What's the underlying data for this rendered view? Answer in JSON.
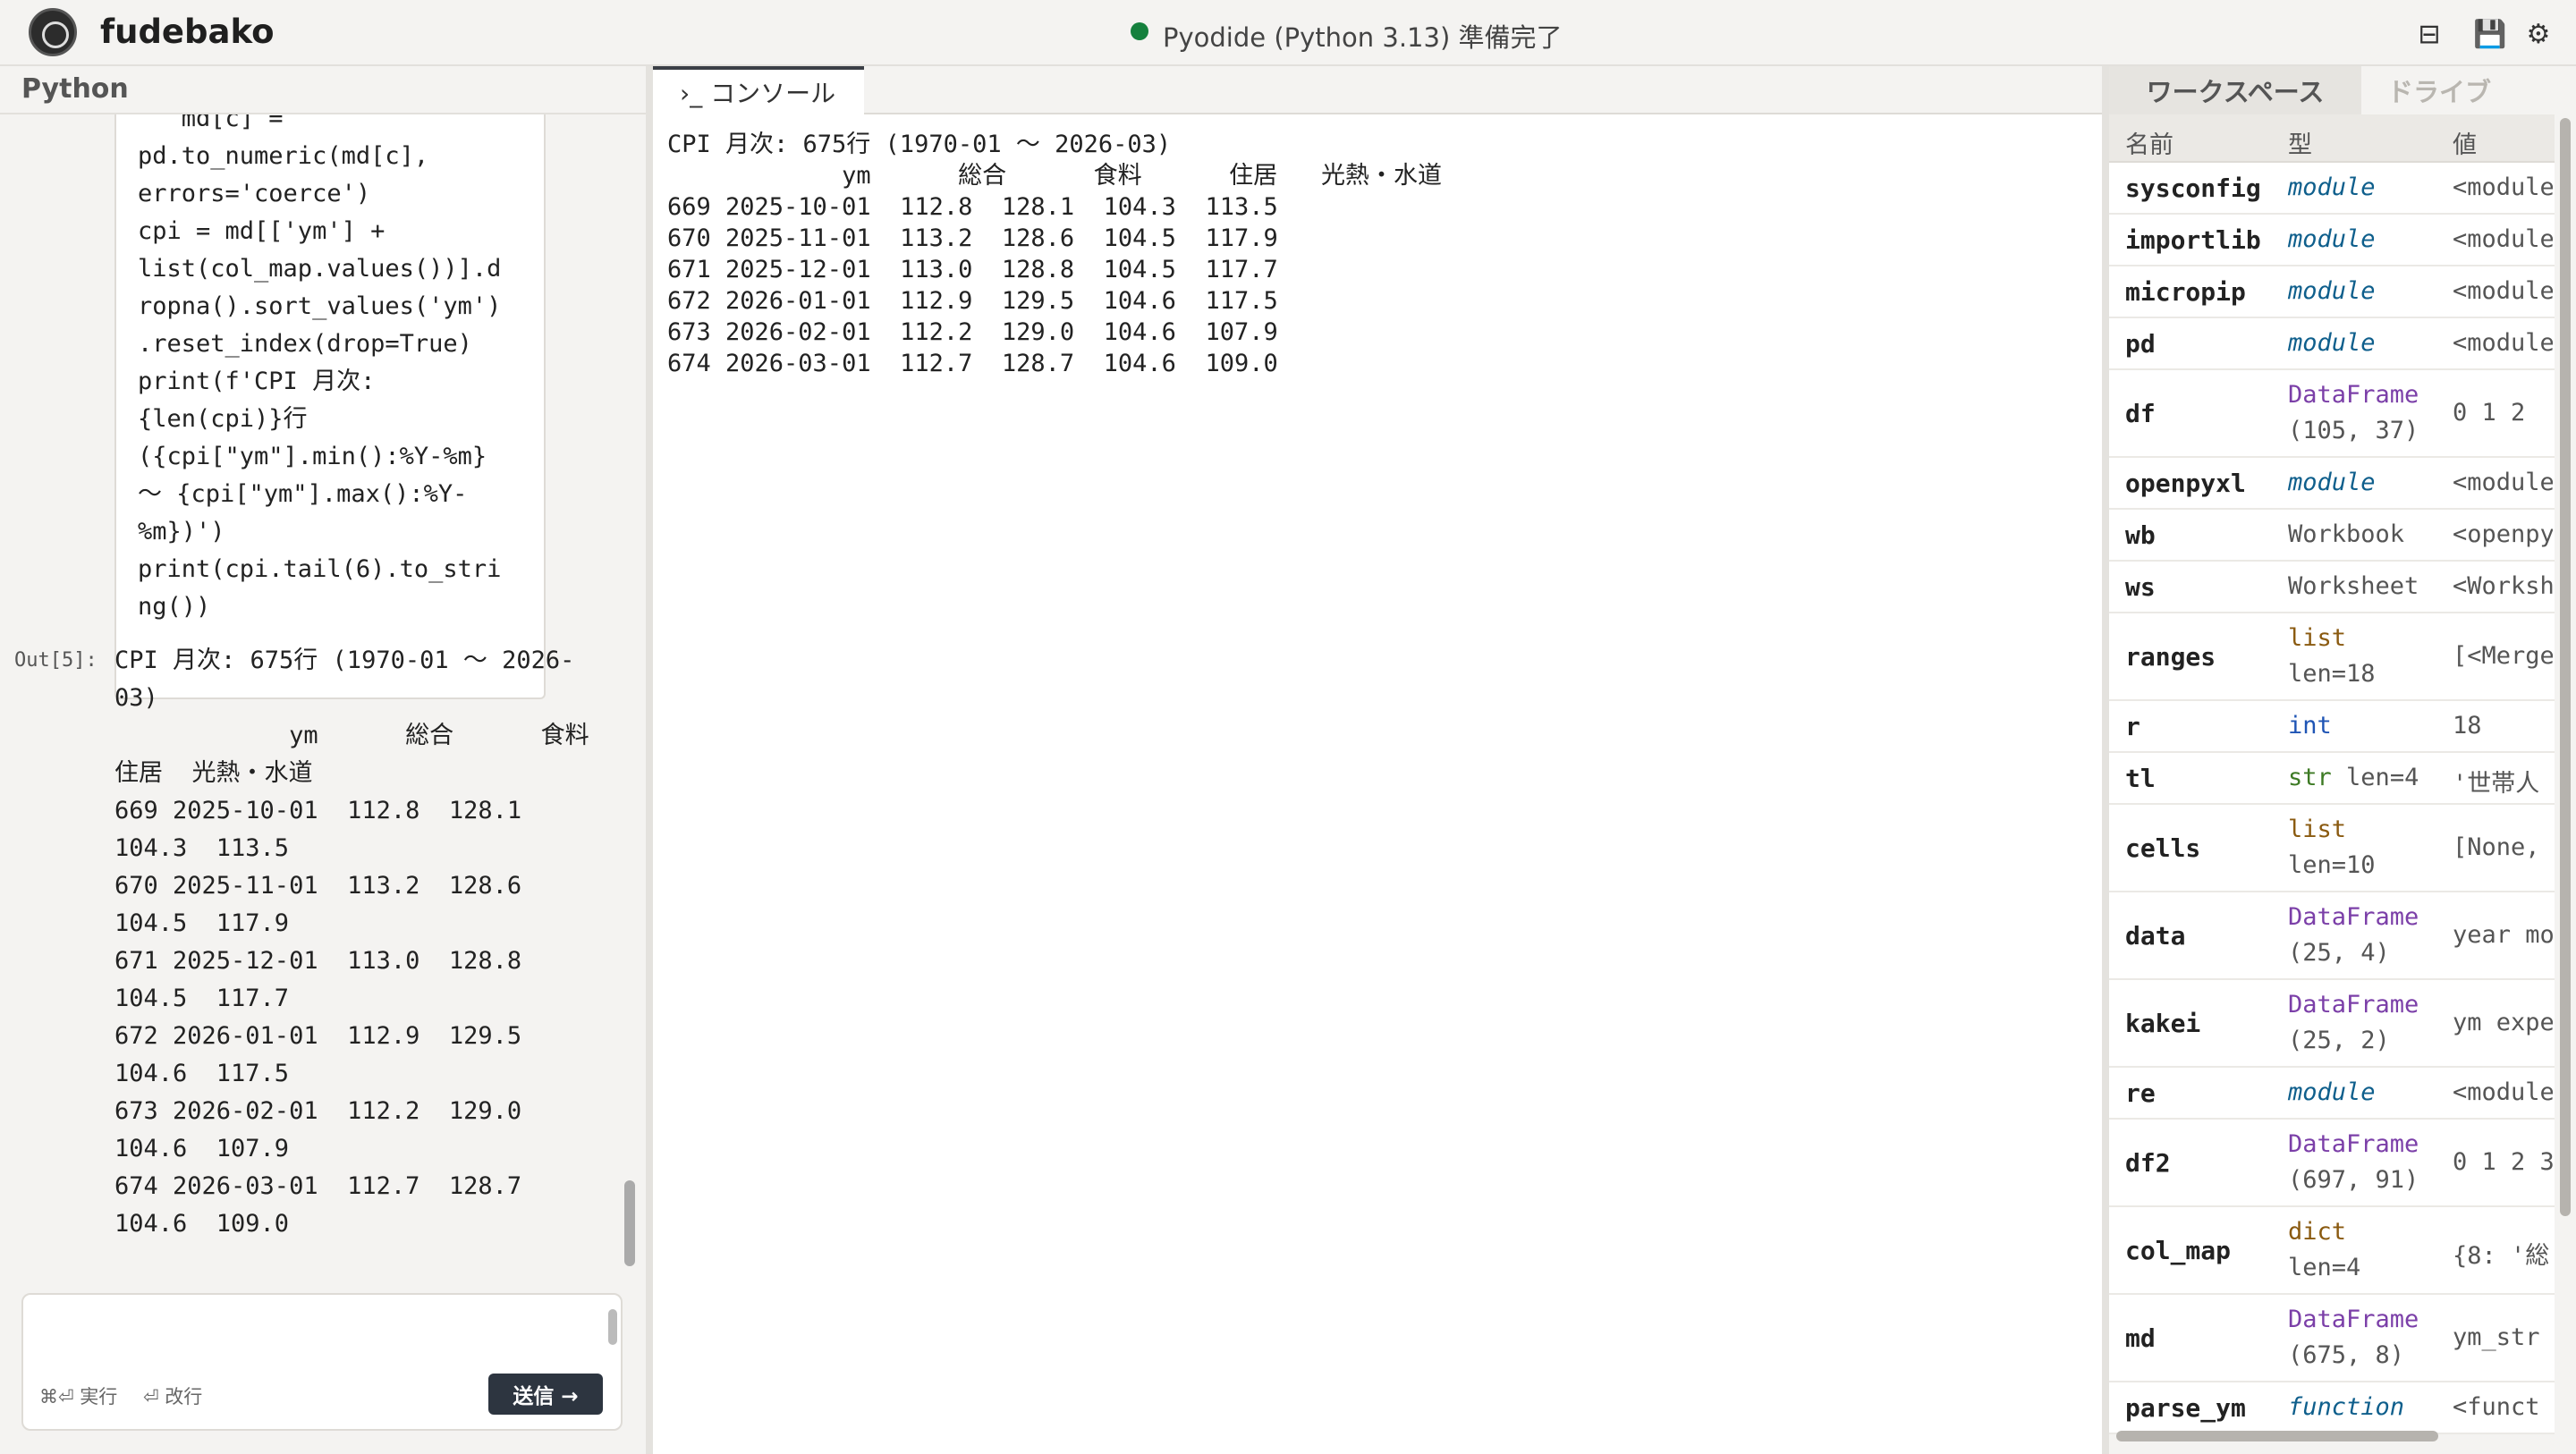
{
  "header": {
    "app_title": "fudebako",
    "status_text": "Pyodide (Python 3.13) 準備完了",
    "status_color": "#15803d",
    "buttons": [
      {
        "name": "layout-toggle-button",
        "glyph": "⊟"
      },
      {
        "name": "save-button",
        "glyph": "💾"
      },
      {
        "name": "settings-button",
        "glyph": "⚙"
      }
    ]
  },
  "left_pane": {
    "title": "Python",
    "code_cell": "   md[c] =\npd.to_numeric(md[c],\nerrors='coerce')\ncpi = md[['ym'] +\nlist(col_map.values())].d\nropna().sort_values('ym')\n.reset_index(drop=True)\nprint(f'CPI 月次:\n{len(cpi)}行\n({cpi[\"ym\"].min():%Y-%m}\n〜 {cpi[\"ym\"].max():%Y-\n%m})')\nprint(cpi.tail(6).to_stri\nng())",
    "out_label": "Out[5]:",
    "output": "CPI 月次: 675行 (1970-01 〜 2026-\n03)\n            ym      総合      食料\n住居  光熱・水道\n669 2025-10-01  112.8  128.1\n104.3  113.5\n670 2025-11-01  113.2  128.6\n104.5  117.9\n671 2025-12-01  113.0  128.8\n104.5  117.7\n672 2026-01-01  112.9  129.5\n104.6  117.5\n673 2026-02-01  112.2  129.0\n104.6  107.9\n674 2026-03-01  112.7  128.7\n104.6  109.0",
    "input": {
      "value": "",
      "placeholder": ""
    },
    "hint_run": "⌘⏎ 実行",
    "hint_newline": "⏎ 改行",
    "send_label": "送信 →"
  },
  "console": {
    "tab_label": "›_ コンソール",
    "output": "CPI 月次: 675行 (1970-01 〜 2026-03)\n            ym      総合      食料      住居   光熱・水道\n669 2025-10-01  112.8  128.1  104.3  113.5\n670 2025-11-01  113.2  128.6  104.5  117.9\n671 2025-12-01  113.0  128.8  104.5  117.7\n672 2026-01-01  112.9  129.5  104.6  117.5\n673 2026-02-01  112.2  129.0  104.6  107.9\n674 2026-03-01  112.7  128.7  104.6  109.0"
  },
  "workspace": {
    "tabs": [
      "ワークスペース",
      "ドライブ"
    ],
    "columns": [
      "名前",
      "型",
      "値"
    ],
    "rows": [
      {
        "name": "sysconfig",
        "type": "module",
        "sub": "",
        "value": "<module",
        "kind": "module"
      },
      {
        "name": "importlib",
        "type": "module",
        "sub": "",
        "value": "<module",
        "kind": "module"
      },
      {
        "name": "micropip",
        "type": "module",
        "sub": "",
        "value": "<module",
        "kind": "module"
      },
      {
        "name": "pd",
        "type": "module",
        "sub": "",
        "value": "<module",
        "kind": "module"
      },
      {
        "name": "df",
        "type": "DataFrame",
        "sub": "(105, 37)",
        "value": "0 1 2",
        "kind": "dataframe"
      },
      {
        "name": "openpyxl",
        "type": "module",
        "sub": "",
        "value": "<module",
        "kind": "module"
      },
      {
        "name": "wb",
        "type": "Workbook",
        "sub": "",
        "value": "<openpy",
        "kind": "plain"
      },
      {
        "name": "ws",
        "type": "Worksheet",
        "sub": "",
        "value": "<Worksh",
        "kind": "plain"
      },
      {
        "name": "ranges",
        "type": "list",
        "sub": "len=18",
        "value": "[<Merge",
        "kind": "list"
      },
      {
        "name": "r",
        "type": "int",
        "sub": "",
        "value": "18",
        "kind": "int"
      },
      {
        "name": "tl",
        "type": "str",
        "sub": "len=4",
        "value": "'世帯人",
        "kind": "str",
        "inline_sub": true
      },
      {
        "name": "cells",
        "type": "list",
        "sub": "len=10",
        "value": "[None,",
        "kind": "list"
      },
      {
        "name": "data",
        "type": "DataFrame",
        "sub": "(25, 4)",
        "value": "year mo",
        "kind": "dataframe"
      },
      {
        "name": "kakei",
        "type": "DataFrame",
        "sub": "(25, 2)",
        "value": "ym expe",
        "kind": "dataframe"
      },
      {
        "name": "re",
        "type": "module",
        "sub": "",
        "value": "<module",
        "kind": "module"
      },
      {
        "name": "df2",
        "type": "DataFrame",
        "sub": "(697, 91)",
        "value": "0 1 2 3",
        "kind": "dataframe"
      },
      {
        "name": "col_map",
        "type": "dict",
        "sub": "len=4",
        "value": "{8: '総",
        "kind": "dict"
      },
      {
        "name": "md",
        "type": "DataFrame",
        "sub": "(675, 8)",
        "value": "ym_str",
        "kind": "dataframe"
      },
      {
        "name": "parse_ym",
        "type": "function",
        "sub": "",
        "value": "<funct",
        "kind": "function"
      }
    ]
  }
}
